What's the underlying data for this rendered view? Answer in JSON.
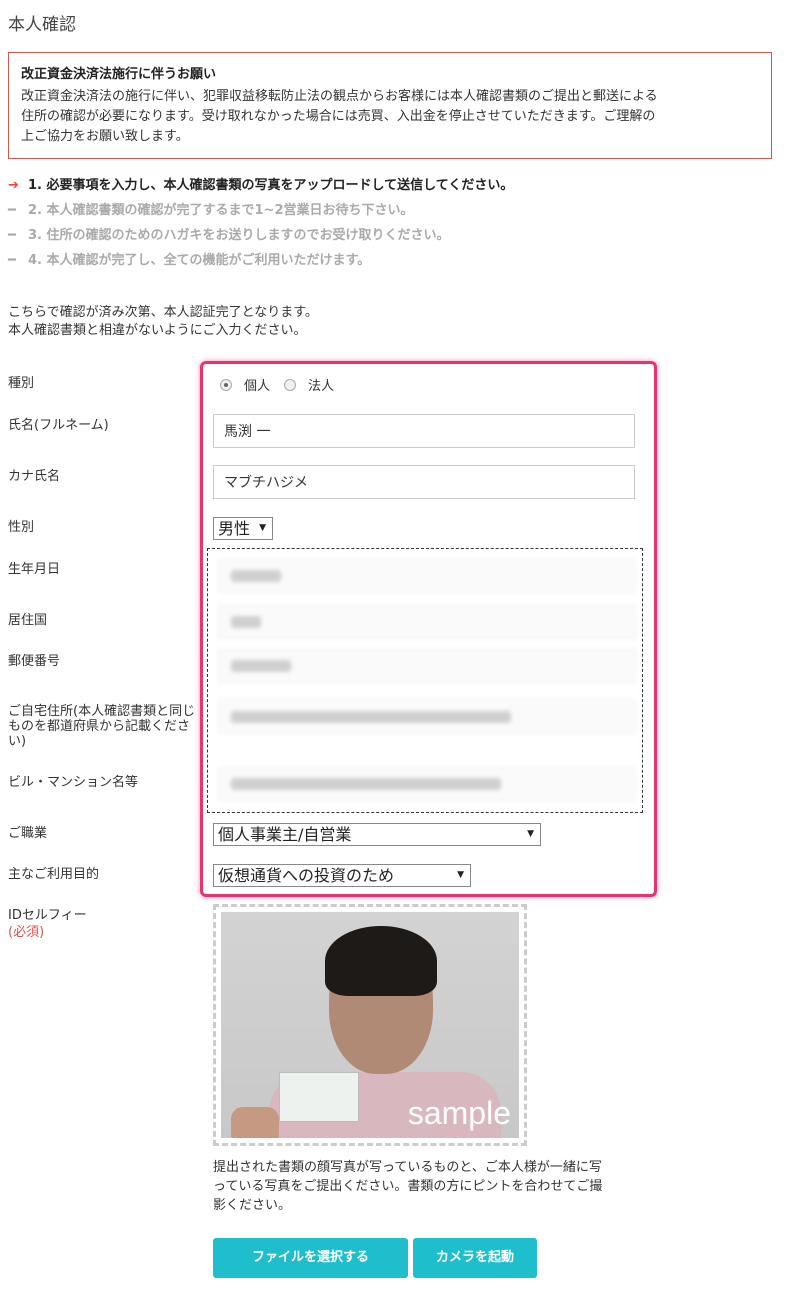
{
  "page_title": "本人確認",
  "notice": {
    "title": "改正資金決済法施行に伴うお願い",
    "lines": [
      "改正資金決済法の施行に伴い、犯罪収益移転防止法の観点からお客様には本人確認書類のご提出と郵送による",
      "住所の確認が必要になります。受け取れなかった場合には売買、入出金を停止させていただきます。ご理解の",
      "上ご協力をお願い致します。"
    ]
  },
  "steps": [
    {
      "mark": "➔",
      "text": "1. 必要事項を入力し、本人確認書類の写真をアップロードして送信してください。"
    },
    {
      "mark": "━",
      "text": "2. 本人確認書類の確認が完了するまで1~2営業日お待ち下さい。"
    },
    {
      "mark": "━",
      "text": "3. 住所の確認のためのハガキをお送りしますのでお受け取りください。"
    },
    {
      "mark": "━",
      "text": "4. 本人確認が完了し、全ての機能がご利用いただけます。"
    }
  ],
  "intro": [
    "こちらで確認が済み次第、本人認証完了となります。",
    "本人確認書類と相違がないようにご入力ください。"
  ],
  "labels": {
    "type": "種別",
    "name": "氏名(フルネーム)",
    "kana": "カナ氏名",
    "gender": "性別",
    "birthday": "生年月日",
    "country": "居住国",
    "postal": "郵便番号",
    "address": "ご自宅住所(本人確認書類と同じものを都道府県から記載ください)",
    "building": "ビル・マンション名等",
    "occupation": "ご職業",
    "purpose": "主なご利用目的",
    "selfie": "IDセルフィー",
    "selfie_required": "(必須)"
  },
  "form": {
    "type_options": [
      "個人",
      "法人"
    ],
    "type_selected": "個人",
    "name_value": "馬渕 一",
    "kana_value": "マブチハジメ",
    "gender_value": "男性",
    "occupation_value": "個人事業主/自営業",
    "purpose_value": "仮想通貨への投資のため"
  },
  "selfie": {
    "sample_label": "sample",
    "note": "提出された書類の顔写真が写っているものと、ご本人様が一緒に写っている写真をご提出ください。書類の方にピントを合わせてご撮影ください。"
  },
  "buttons": {
    "select_file": "ファイルを選択する",
    "camera": "カメラを起動"
  },
  "colors": {
    "accent_button": "#1fbecc",
    "highlight_border": "#e8336d",
    "notice_border": "#d9534f",
    "required_text": "#d9534f"
  }
}
